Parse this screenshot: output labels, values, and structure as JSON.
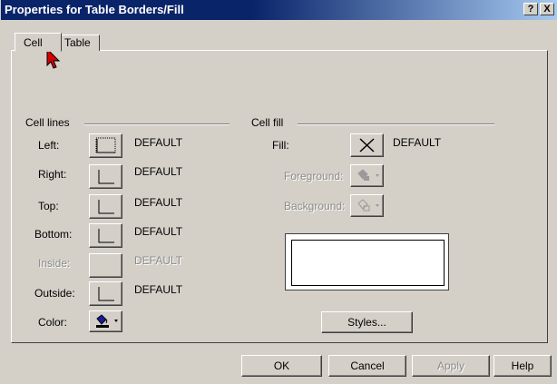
{
  "window": {
    "title": "Properties for Table Borders/Fill",
    "help_glyph": "?",
    "close_glyph": "X"
  },
  "tabs": [
    {
      "label": "Cell",
      "active": true
    },
    {
      "label": "Table",
      "active": false
    }
  ],
  "cell_lines": {
    "heading": "Cell lines",
    "rows": [
      {
        "label": "Left:",
        "value": "DEFAULT",
        "enabled": true
      },
      {
        "label": "Right:",
        "value": "DEFAULT",
        "enabled": true
      },
      {
        "label": "Top:",
        "value": "DEFAULT",
        "enabled": true
      },
      {
        "label": "Bottom:",
        "value": "DEFAULT",
        "enabled": true
      },
      {
        "label": "Inside:",
        "value": "DEFAULT",
        "enabled": false
      },
      {
        "label": "Outside:",
        "value": "DEFAULT",
        "enabled": true
      }
    ],
    "color_label": "Color:"
  },
  "cell_fill": {
    "heading": "Cell fill",
    "fill_label": "Fill:",
    "fill_value": "DEFAULT",
    "foreground_label": "Foreground:",
    "background_label": "Background:",
    "styles_button": "Styles..."
  },
  "buttons": {
    "ok": "OK",
    "cancel": "Cancel",
    "apply": "Apply",
    "help": "Help"
  },
  "colors": {
    "dialog_bg": "#d4d0c8",
    "title_start": "#0a246a",
    "title_end": "#a6caf0",
    "cursor": "#d40000"
  }
}
